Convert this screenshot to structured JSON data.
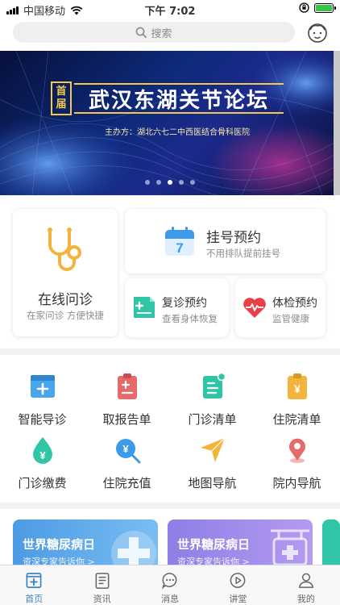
{
  "status_bar": {
    "carrier": "中国移动",
    "time": "下午 7:02"
  },
  "search": {
    "placeholder": "搜索"
  },
  "banner": {
    "tag": [
      "首",
      "届"
    ],
    "title": "武汉东湖关节论坛",
    "subtitle": "主办方：湖北六七二中西医结合骨科医院",
    "slide_count": 5,
    "active_slide": 3
  },
  "services": {
    "online": {
      "title": "在线问诊",
      "subtitle": "在家问诊 方便快捷"
    },
    "register": {
      "title": "挂号预约",
      "subtitle": "不用排队提前挂号",
      "calendar_day": "7"
    },
    "revisit": {
      "title": "复诊预约",
      "subtitle": "查看身体恢复"
    },
    "exam": {
      "title": "体检预约",
      "subtitle": "监管健康"
    }
  },
  "grid": [
    {
      "label": "智能导诊",
      "icon": "guide-icon"
    },
    {
      "label": "取报告单",
      "icon": "report-icon"
    },
    {
      "label": "门诊清单",
      "icon": "outpatient-list-icon"
    },
    {
      "label": "住院清单",
      "icon": "inpatient-list-icon"
    },
    {
      "label": "门诊缴费",
      "icon": "payment-icon"
    },
    {
      "label": "住院充值",
      "icon": "recharge-icon"
    },
    {
      "label": "地图导航",
      "icon": "map-nav-icon"
    },
    {
      "label": "院内导航",
      "icon": "hospital-nav-icon"
    }
  ],
  "promos": [
    {
      "title": "世界糖尿病日",
      "subtitle": "资深专家告诉你 >"
    },
    {
      "title": "世界糖尿病日",
      "subtitle": "资深专家告诉你 >"
    }
  ],
  "tabs": [
    {
      "label": "首页",
      "active": true
    },
    {
      "label": "资讯",
      "active": false
    },
    {
      "label": "消息",
      "active": false
    },
    {
      "label": "讲堂",
      "active": false
    },
    {
      "label": "我的",
      "active": false
    }
  ],
  "colors": {
    "accent": "#3d85c6",
    "orange": "#f3b43b",
    "green": "#2fc5a6",
    "red": "#e8414a",
    "promo_blue": "#5aa7e8",
    "promo_purple": "#9c82e6"
  }
}
